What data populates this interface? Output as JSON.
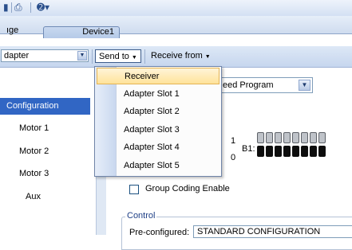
{
  "tabs": [
    {
      "label": "ıge",
      "active": false
    },
    {
      "label": "Device1",
      "active": true
    }
  ],
  "toolbar": {
    "combo_value": "dapter",
    "send_to": "Send to",
    "receive_from": "Receive from"
  },
  "sidebar": {
    "items": [
      "Configuration",
      "Motor 1",
      "Motor 2",
      "Motor 3",
      "Aux"
    ],
    "selected": "Configuration"
  },
  "send_menu": {
    "items": [
      "Receiver",
      "Adapter Slot 1",
      "Adapter Slot 2",
      "Adapter Slot 3",
      "Adapter Slot 4",
      "Adapter Slot 5"
    ],
    "highlighted": "Receiver"
  },
  "main": {
    "program_select": "eed Program",
    "bit_row_a_value": "1",
    "bit_row_b_value": "0",
    "b1_label": "B1:",
    "b1_bits": [
      0,
      0,
      0,
      0,
      0,
      0,
      0,
      0,
      1,
      1,
      1,
      1,
      1,
      1,
      1,
      1
    ],
    "group_coding_label": "Group Coding Enable",
    "group_coding_checked": false,
    "control_group_title": "Control",
    "preconfigured_label": "Pre-configured:",
    "preconfigured_value": "STANDARD CONFIGURATION"
  },
  "colors": {
    "selection": "#3166c4",
    "menu_hover": "#ffe39a"
  }
}
